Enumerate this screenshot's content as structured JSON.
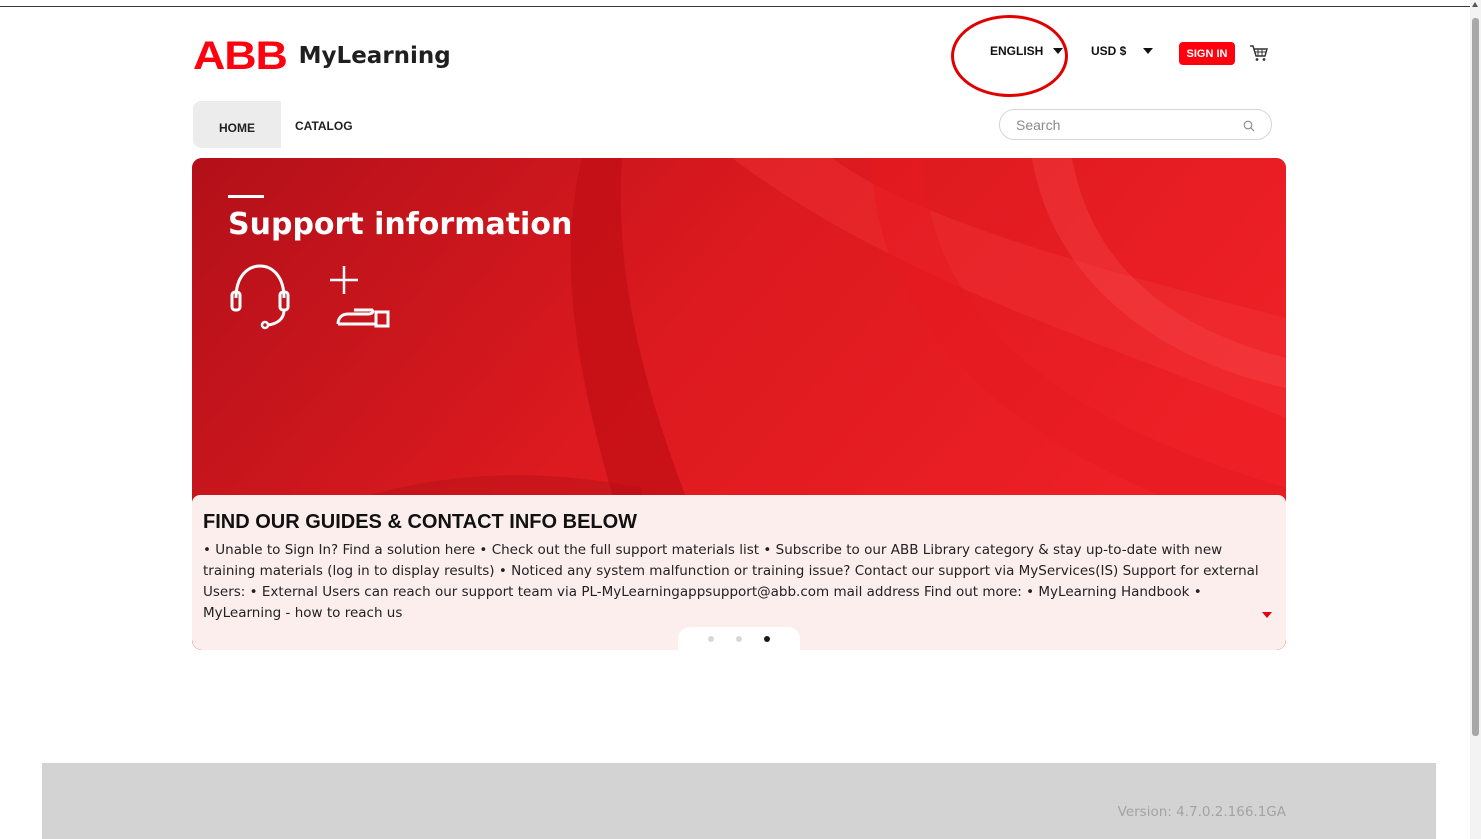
{
  "header": {
    "logo_text": "ABB",
    "product_name": "MyLearning",
    "language": "ENGLISH",
    "currency": "USD $",
    "sign_in_label": "SIGN IN",
    "cart_icon": "shopping-cart-icon",
    "accent_color": "#ff000f"
  },
  "nav": {
    "items": [
      {
        "label": "HOME",
        "active": true
      },
      {
        "label": "CATALOG",
        "active": false
      }
    ]
  },
  "search": {
    "placeholder": "Search",
    "value": "",
    "icon": "search-icon"
  },
  "banner": {
    "headline": "Support information",
    "icons": [
      "headset-icon",
      "hand-plus-icon"
    ],
    "background_color": "#d4141a",
    "info_title": "FIND OUR GUIDES & CONTACT INFO BELOW",
    "info_text": "• Unable to Sign In? Find a solution here • Check out the full support materials list • Subscribe to our ABB Library category & stay up-to-date with new training materials (log in to display results) • Noticed any system malfunction or training issue? Contact our support via MyServices(IS) Support for external Users: • External Users can reach our support team via PL-MyLearningappsupport@abb.com mail address Find out more: • MyLearning Handbook • MyLearning - how to reach us",
    "slide_count": 3,
    "active_slide": 3
  },
  "footer": {
    "version": "Version: 4.7.0.2.166.1GA"
  },
  "annotation": {
    "color": "#e10000",
    "target": "language selector"
  }
}
